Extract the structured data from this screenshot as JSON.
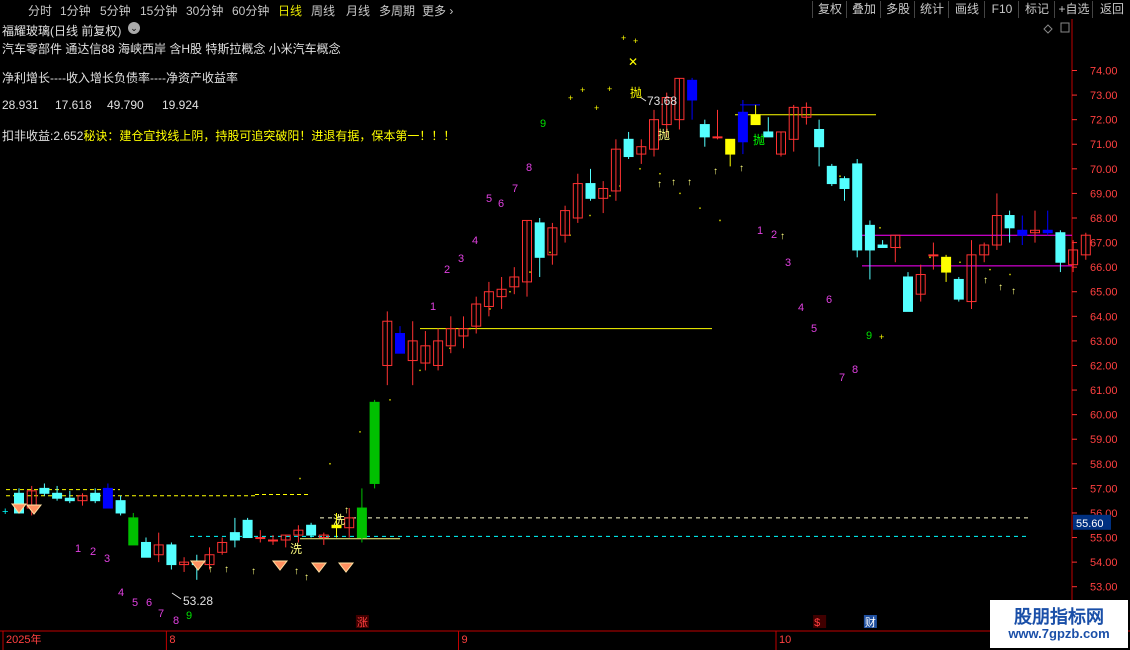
{
  "toolbar": {
    "periods": [
      "分时",
      "1分钟",
      "5分钟",
      "15分钟",
      "30分钟",
      "60分钟",
      "日线",
      "周线",
      "月线",
      "多周期",
      "更多"
    ],
    "active_period": "日线",
    "right_buttons": [
      "复权",
      "叠加",
      "多股",
      "统计",
      "画线",
      "F10",
      "标记",
      "+自选",
      "返回"
    ]
  },
  "header": {
    "title": "福耀玻璃(日线 前复权)",
    "concepts": "汽车零部件 通达信88 海峡西岸 含H股 特斯拉概念 小米汽车概念",
    "indicator_names": "净利增长----收入增长负债率----净资产收益率",
    "indicator_values": [
      "28.931",
      "17.618",
      "49.790",
      "19.924"
    ],
    "deduct_label": "扣非收益:",
    "deduct_value": "2.652",
    "tip": "秘诀：建仓宜找线上阴，持股可追突破阳！进退有据，保本第一！！！"
  },
  "colors": {
    "up": "#ff3232",
    "down": "#54ffff",
    "blue": "#0000ff",
    "yellow": "#ffff00",
    "green": "#00c000",
    "magenta": "#ff00ff",
    "grid": "#7a0000",
    "axis": "#ff3232"
  },
  "chart_data": {
    "type": "candlestick",
    "ylim": [
      52.5,
      75.2
    ],
    "y_ticks": [
      53.0,
      54.0,
      55.0,
      56.0,
      57.0,
      58.0,
      59.0,
      60.0,
      61.0,
      62.0,
      63.0,
      64.0,
      65.0,
      66.0,
      67.0,
      68.0,
      69.0,
      70.0,
      71.0,
      72.0,
      73.0,
      74.0
    ],
    "current_price_label": "55.60",
    "high_label": "73.68",
    "low_label": "53.28",
    "x_labels": [
      {
        "i": 0,
        "text": "2025年"
      },
      {
        "i": 12,
        "text": "8"
      },
      {
        "i": 35,
        "text": "9"
      },
      {
        "i": 60,
        "text": "10"
      }
    ],
    "event_markers": [
      {
        "i": 27,
        "text": "涨"
      },
      {
        "i": 63,
        "text": "$"
      },
      {
        "i": 67,
        "text": "财"
      }
    ],
    "signals": [
      {
        "i": 27,
        "text": "洗"
      },
      {
        "i": 22,
        "text": "洗"
      },
      {
        "i": 51,
        "text": "抛"
      },
      {
        "i": 53,
        "text": "抛"
      },
      {
        "i": 61,
        "text": "抛"
      }
    ],
    "candles": [
      {
        "o": 56.8,
        "h": 57.0,
        "l": 56.0,
        "c": 56.0
      },
      {
        "o": 56.2,
        "h": 57.1,
        "l": 55.9,
        "c": 56.9
      },
      {
        "o": 57.0,
        "h": 57.2,
        "l": 56.7,
        "c": 56.8
      },
      {
        "o": 56.8,
        "h": 57.1,
        "l": 56.5,
        "c": 56.6
      },
      {
        "o": 56.6,
        "h": 56.9,
        "l": 56.4,
        "c": 56.5
      },
      {
        "o": 56.5,
        "h": 56.8,
        "l": 56.3,
        "c": 56.7
      },
      {
        "o": 56.8,
        "h": 57.0,
        "l": 56.4,
        "c": 56.5
      },
      {
        "o": 57.0,
        "h": 57.2,
        "l": 56.2,
        "c": 56.2
      },
      {
        "o": 56.5,
        "h": 56.7,
        "l": 55.9,
        "c": 56.0
      },
      {
        "o": 55.8,
        "h": 56.0,
        "l": 54.7,
        "c": 54.7
      },
      {
        "o": 54.8,
        "h": 55.0,
        "l": 54.2,
        "c": 54.2
      },
      {
        "o": 54.3,
        "h": 55.2,
        "l": 54.0,
        "c": 54.7
      },
      {
        "o": 54.7,
        "h": 54.8,
        "l": 53.7,
        "c": 53.9
      },
      {
        "o": 53.9,
        "h": 54.2,
        "l": 53.6,
        "c": 54.0
      },
      {
        "o": 54.0,
        "h": 54.3,
        "l": 53.28,
        "c": 53.9
      },
      {
        "o": 53.9,
        "h": 54.6,
        "l": 53.7,
        "c": 54.3
      },
      {
        "o": 54.4,
        "h": 55.0,
        "l": 54.3,
        "c": 54.8
      },
      {
        "o": 55.2,
        "h": 55.8,
        "l": 54.6,
        "c": 54.9
      },
      {
        "o": 55.7,
        "h": 55.8,
        "l": 55.0,
        "c": 55.0
      },
      {
        "o": 55.0,
        "h": 55.3,
        "l": 54.8,
        "c": 55.0
      },
      {
        "o": 54.9,
        "h": 55.1,
        "l": 54.7,
        "c": 54.9
      },
      {
        "o": 54.9,
        "h": 55.1,
        "l": 54.6,
        "c": 55.1
      },
      {
        "o": 55.1,
        "h": 55.5,
        "l": 54.8,
        "c": 55.3
      },
      {
        "o": 55.5,
        "h": 55.6,
        "l": 55.0,
        "c": 55.1
      },
      {
        "o": 55.0,
        "h": 55.2,
        "l": 54.7,
        "c": 55.1
      },
      {
        "o": 55.5,
        "h": 56.0,
        "l": 55.0,
        "c": 55.4
      },
      {
        "o": 55.4,
        "h": 56.2,
        "l": 55.0,
        "c": 55.8
      },
      {
        "o": 55.0,
        "h": 57.0,
        "l": 54.8,
        "c": 56.2
      },
      {
        "o": 57.2,
        "h": 60.6,
        "l": 57.0,
        "c": 60.5
      },
      {
        "o": 62.0,
        "h": 64.2,
        "l": 61.2,
        "c": 63.8
      },
      {
        "o": 63.3,
        "h": 63.6,
        "l": 62.5,
        "c": 62.5
      },
      {
        "o": 62.2,
        "h": 63.8,
        "l": 61.2,
        "c": 63.0
      },
      {
        "o": 62.1,
        "h": 63.4,
        "l": 61.8,
        "c": 62.8
      },
      {
        "o": 62.0,
        "h": 63.5,
        "l": 61.8,
        "c": 63.0
      },
      {
        "o": 62.8,
        "h": 64.0,
        "l": 62.5,
        "c": 63.5
      },
      {
        "o": 63.2,
        "h": 64.0,
        "l": 62.7,
        "c": 63.5
      },
      {
        "o": 63.6,
        "h": 64.8,
        "l": 63.3,
        "c": 64.5
      },
      {
        "o": 64.4,
        "h": 65.4,
        "l": 64.0,
        "c": 65.0
      },
      {
        "o": 64.8,
        "h": 65.6,
        "l": 64.3,
        "c": 65.1
      },
      {
        "o": 65.2,
        "h": 66.0,
        "l": 64.9,
        "c": 65.6
      },
      {
        "o": 65.4,
        "h": 67.9,
        "l": 64.8,
        "c": 67.9
      },
      {
        "o": 67.8,
        "h": 68.0,
        "l": 65.6,
        "c": 66.4
      },
      {
        "o": 66.5,
        "h": 67.8,
        "l": 66.1,
        "c": 67.6
      },
      {
        "o": 67.3,
        "h": 68.5,
        "l": 67.0,
        "c": 68.3
      },
      {
        "o": 68.0,
        "h": 69.8,
        "l": 67.8,
        "c": 69.4
      },
      {
        "o": 69.4,
        "h": 70.0,
        "l": 68.7,
        "c": 68.8
      },
      {
        "o": 68.8,
        "h": 69.5,
        "l": 68.2,
        "c": 69.2
      },
      {
        "o": 69.1,
        "h": 71.2,
        "l": 68.7,
        "c": 70.8
      },
      {
        "o": 71.2,
        "h": 71.5,
        "l": 70.4,
        "c": 70.5
      },
      {
        "o": 70.6,
        "h": 71.2,
        "l": 70.2,
        "c": 70.9
      },
      {
        "o": 70.8,
        "h": 72.4,
        "l": 70.5,
        "c": 72.0
      },
      {
        "o": 71.8,
        "h": 73.1,
        "l": 71.3,
        "c": 72.9
      },
      {
        "o": 72.0,
        "h": 73.68,
        "l": 71.6,
        "c": 73.68
      },
      {
        "o": 73.6,
        "h": 73.7,
        "l": 72.0,
        "c": 72.8
      },
      {
        "o": 71.8,
        "h": 72.0,
        "l": 70.9,
        "c": 71.3
      },
      {
        "o": 71.3,
        "h": 72.4,
        "l": 71.2,
        "c": 71.3
      },
      {
        "o": 70.6,
        "h": 71.2,
        "l": 70.1,
        "c": 71.2
      },
      {
        "o": 71.1,
        "h": 72.8,
        "l": 70.6,
        "c": 72.3
      },
      {
        "o": 72.2,
        "h": 72.6,
        "l": 71.8,
        "c": 71.8
      },
      {
        "o": 71.5,
        "h": 72.1,
        "l": 71.3,
        "c": 71.3
      },
      {
        "o": 70.6,
        "h": 71.5,
        "l": 70.5,
        "c": 71.5
      },
      {
        "o": 71.2,
        "h": 72.6,
        "l": 70.7,
        "c": 72.5
      },
      {
        "o": 72.1,
        "h": 72.7,
        "l": 71.8,
        "c": 72.5
      },
      {
        "o": 71.6,
        "h": 72.0,
        "l": 70.1,
        "c": 70.9
      },
      {
        "o": 70.1,
        "h": 70.2,
        "l": 69.3,
        "c": 69.4
      },
      {
        "o": 69.6,
        "h": 69.7,
        "l": 68.7,
        "c": 69.2
      },
      {
        "o": 70.2,
        "h": 70.4,
        "l": 66.4,
        "c": 66.7
      },
      {
        "o": 67.7,
        "h": 67.9,
        "l": 65.5,
        "c": 66.7
      },
      {
        "o": 66.9,
        "h": 67.1,
        "l": 66.8,
        "c": 66.8
      },
      {
        "o": 66.8,
        "h": 67.3,
        "l": 66.2,
        "c": 67.3
      },
      {
        "o": 65.6,
        "h": 65.8,
        "l": 64.2,
        "c": 64.2
      },
      {
        "o": 64.9,
        "h": 66.1,
        "l": 64.6,
        "c": 65.7
      },
      {
        "o": 66.5,
        "h": 67.0,
        "l": 65.9,
        "c": 66.5
      },
      {
        "o": 66.4,
        "h": 66.5,
        "l": 65.4,
        "c": 65.8
      },
      {
        "o": 65.5,
        "h": 65.6,
        "l": 64.6,
        "c": 64.7
      },
      {
        "o": 64.6,
        "h": 67.1,
        "l": 64.3,
        "c": 66.5
      },
      {
        "o": 66.5,
        "h": 67.0,
        "l": 66.2,
        "c": 66.9
      },
      {
        "o": 66.9,
        "h": 69.0,
        "l": 66.7,
        "c": 68.1
      },
      {
        "o": 68.1,
        "h": 68.3,
        "l": 67.0,
        "c": 67.6
      },
      {
        "o": 67.3,
        "h": 68.1,
        "l": 66.9,
        "c": 67.5
      },
      {
        "o": 67.4,
        "h": 68.3,
        "l": 67.0,
        "c": 67.5
      },
      {
        "o": 67.4,
        "h": 68.3,
        "l": 67.3,
        "c": 67.5
      },
      {
        "o": 67.4,
        "h": 67.5,
        "l": 65.8,
        "c": 66.2
      },
      {
        "o": 66.1,
        "h": 67.1,
        "l": 65.8,
        "c": 66.7
      },
      {
        "o": 66.5,
        "h": 67.4,
        "l": 66.3,
        "c": 67.3
      }
    ]
  }
}
